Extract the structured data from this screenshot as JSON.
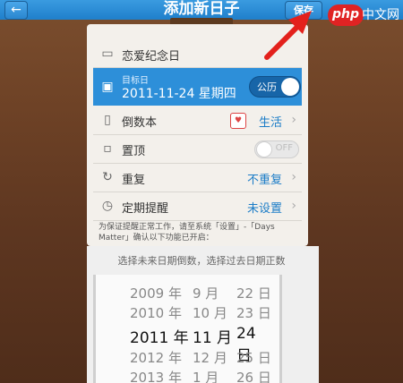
{
  "nav": {
    "back_glyph": "←",
    "title": "添加新日子",
    "save_label": "保存"
  },
  "watermark": {
    "logo": "php",
    "text": "中文网"
  },
  "rows": {
    "name": {
      "label": "恋爱纪念日"
    },
    "target": {
      "small_label": "目标日",
      "date_text": "2011-11-24 星期四",
      "calendar_label": "公历"
    },
    "book": {
      "label": "倒数本",
      "value": "生活"
    },
    "pin": {
      "label": "置顶",
      "toggle_text": "OFF"
    },
    "repeat": {
      "label": "重复",
      "value": "不重复"
    },
    "reminder": {
      "label": "定期提醒",
      "value": "未设置"
    }
  },
  "note": "为保证提醒正常工作，请至系统「设置」-「Days Matter」确认以下功能已开启：",
  "picker": {
    "hint": "选择未来日期倒数，选择过去日期正数",
    "years": [
      "2009 年",
      "2010 年",
      "2011 年",
      "2012 年",
      "2013 年"
    ],
    "months": [
      "9 月",
      "10 月",
      "11 月",
      "12 月",
      "1 月"
    ],
    "days": [
      "22 日",
      "23 日",
      "24 日",
      "25 日",
      "26 日"
    ],
    "selected_index": 2
  },
  "colors": {
    "nav_blue": "#2d8fd9",
    "link_blue": "#1b7cc7",
    "watermark_red": "#e02323"
  }
}
